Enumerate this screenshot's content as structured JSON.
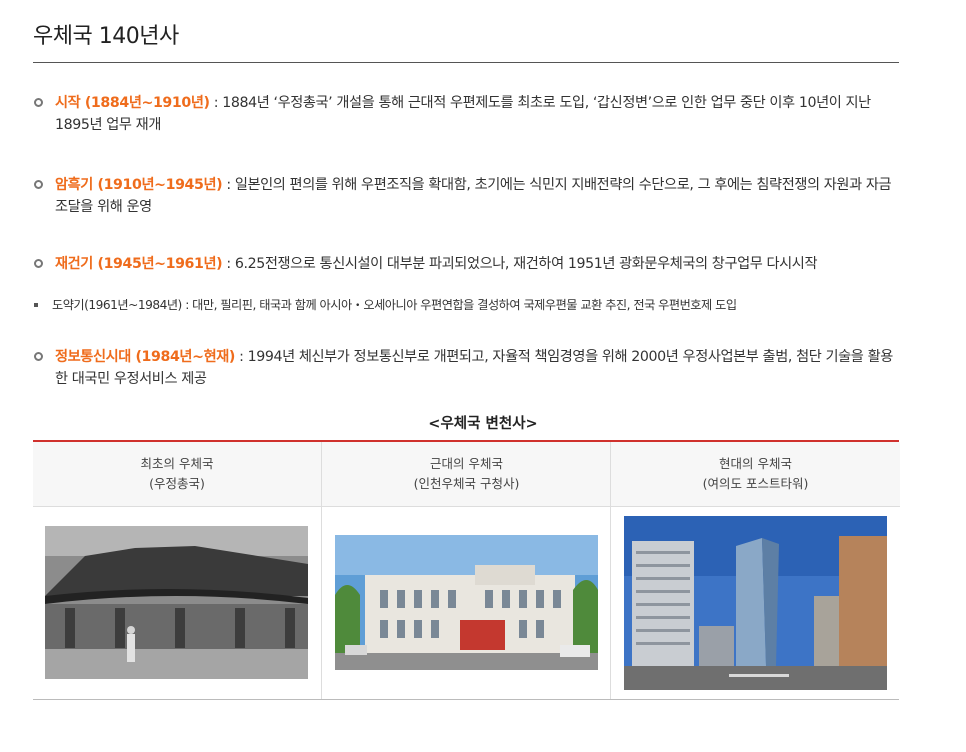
{
  "page": {
    "title": "우체국 140년사"
  },
  "entries": [
    {
      "period": "시작 (1884년~1910년)",
      "text": " : 1884년 ‘우정총국’ 개설을 통해 근대적 우편제도를 최초로 도입, ‘갑신정변’으로 인한 업무 중단 이후 10년이 지난 1895년 업무 재개"
    },
    {
      "period": "암흑기 (1910년~1945년)",
      "text": " : 일본인의 편의를 위해 우편조직을 확대함, 초기에는 식민지 지배전략의 수단으로, 그 후에는 침략전쟁의 자원과 자금조달을 위해 운영"
    },
    {
      "period": "재건기 (1945년~1961년)",
      "text": " : 6.25전쟁으로 통신시설이 대부분 파괴되었으나, 재건하여 1951년 광화문우체국의 창구업무 다시시작"
    },
    {
      "text": "도약기(1961년~1984년) : 대만, 필리핀, 태국과 함께 아시아・오세아니아 우편연합을 결성하여 국제우편물 교환 추진, 전국 우편번호제 도입"
    },
    {
      "period": "정보통신시대 (1984년~현재)",
      "text": " : 1994년 체신부가 정보통신부로 개편되고, 자율적 책임경영을 위해 2000년 우정사업본부 출범, 첨단 기술을 활용한 대국민 우정서비스 제공"
    }
  ],
  "table": {
    "caption": "<우체국 변천사>",
    "columns": [
      {
        "line1": "최초의 우체국",
        "line2": "(우정총국)"
      },
      {
        "line1": "근대의 우체국",
        "line2": "(인천우체국 구청사)"
      },
      {
        "line1": "현대의 우체국",
        "line2": "(여의도 포스트타워)"
      }
    ]
  },
  "colors": {
    "accent": "#ef6c1c",
    "table_border": "#d0312d"
  }
}
